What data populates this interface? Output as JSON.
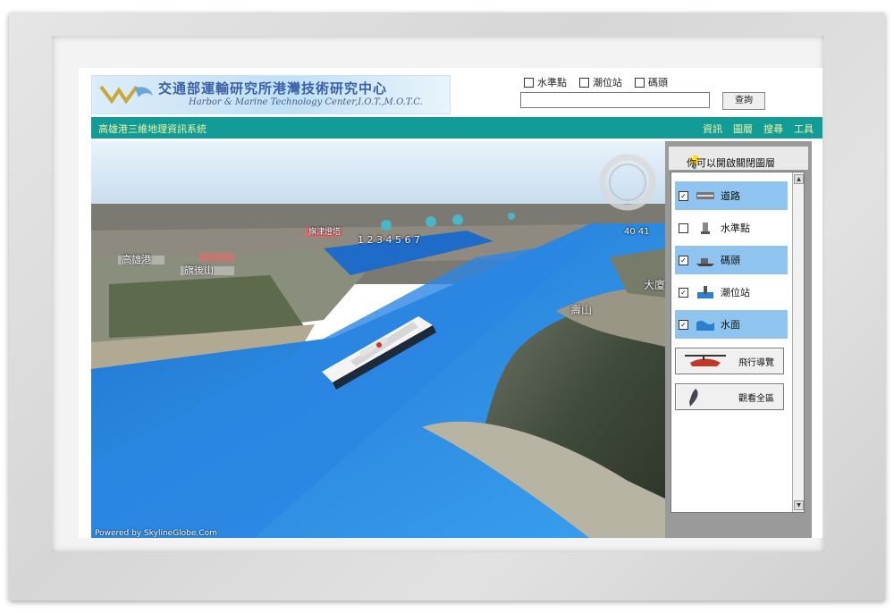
{
  "header": {
    "title_zh": "交通部運輸研究所港灣技術研究中心",
    "title_en": "Harbor & Marine Technology Center,I.O.T.,M.O.T.C."
  },
  "top_layers": [
    {
      "label": "水準點",
      "checked": false
    },
    {
      "label": "潮位站",
      "checked": false
    },
    {
      "label": "碼頭",
      "checked": false
    }
  ],
  "search": {
    "value": "",
    "button_label": "查詢"
  },
  "navbar": {
    "system_title": "高雄港三維地理資訊系統",
    "menu": [
      "資訊",
      "圖層",
      "搜尋",
      "工具"
    ]
  },
  "map": {
    "labels": {
      "top_marker": "旗津燈塔",
      "left_marker_1": "高雄港",
      "left_marker_2": "旗後山",
      "right_top": "大廈",
      "right_mid": "壽山",
      "numbers": "1 2 3 4 5 6 7",
      "right_numbers": "40 41"
    },
    "powered_by": "Powered by SkylineGlobe.Com"
  },
  "panel": {
    "heading": "你可以開啟關閉圖層",
    "layers": [
      {
        "label": "道路",
        "checked": true,
        "icon": "road-icon"
      },
      {
        "label": "水準點",
        "checked": false,
        "icon": "benchmark-icon"
      },
      {
        "label": "碼頭",
        "checked": true,
        "icon": "pier-icon"
      },
      {
        "label": "潮位站",
        "checked": true,
        "icon": "tide-station-icon"
      },
      {
        "label": "水面",
        "checked": true,
        "icon": "water-surface-icon"
      }
    ],
    "buttons": [
      {
        "label": "飛行導覽",
        "icon": "helicopter-icon"
      },
      {
        "label": "觀看全區",
        "icon": "taiwan-map-icon"
      }
    ]
  },
  "colors": {
    "navbar": "#129c98",
    "water": "#2f8fe6",
    "layer_highlight": "#8ec4ef"
  }
}
